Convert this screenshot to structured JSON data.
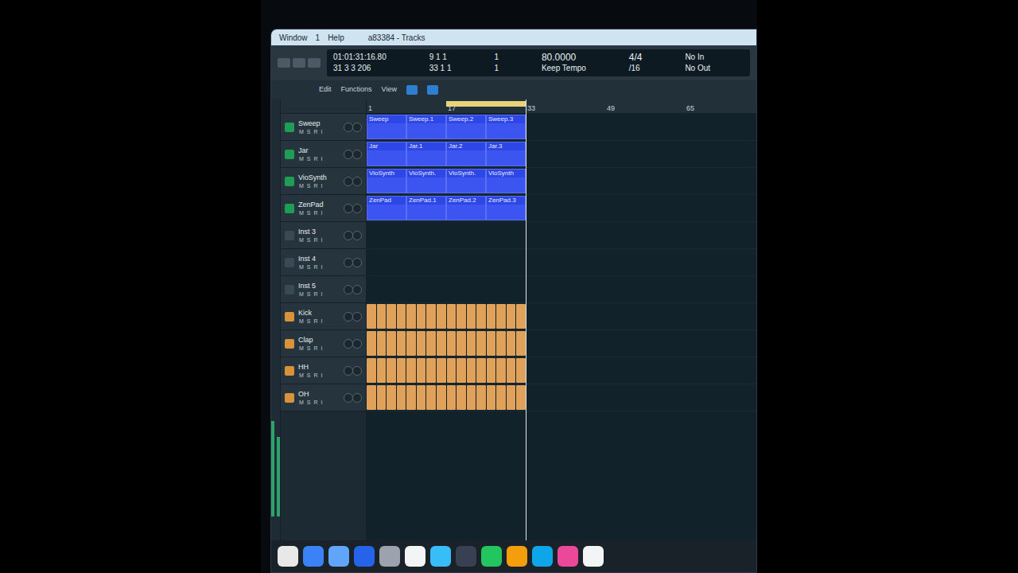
{
  "menu": {
    "items": [
      "Window",
      "1",
      "Help"
    ],
    "title": "a83384 - Tracks"
  },
  "lcd": {
    "time": "01:01:31:16.80",
    "bars": "31 3 3 206",
    "position_top": "9 1 1",
    "position_bottom": "33 1 1",
    "one_top": "1",
    "one_bottom": "1",
    "tempo": "80.0000",
    "tempo_mode": "Keep Tempo",
    "signature": "4/4",
    "division": "/16",
    "input": "No In",
    "output": "No Out"
  },
  "toolbar": [
    "Edit",
    "Functions",
    "View"
  ],
  "ruler": [
    "1",
    "17",
    "33",
    "49",
    "65"
  ],
  "tracks": [
    {
      "name": "Sweep",
      "kind": "audio",
      "active": true,
      "level": 0.55,
      "regions": [
        "Sweep",
        "Sweep.1",
        "Sweep.2",
        "Sweep.3"
      ]
    },
    {
      "name": "Jar",
      "kind": "audio",
      "active": true,
      "level": 0.6,
      "regions": [
        "Jar",
        "Jar.1",
        "Jar.2",
        "Jar.3"
      ]
    },
    {
      "name": "VioSynth",
      "kind": "audio",
      "active": true,
      "level": 0.6,
      "regions": [
        "VioSynth",
        "VioSynth.",
        "VioSynth.",
        "VioSynth"
      ]
    },
    {
      "name": "ZenPad",
      "kind": "audio",
      "active": true,
      "level": 0.65,
      "regions": [
        "ZenPad",
        "ZenPad.1",
        "ZenPad.2",
        "ZenPad.3"
      ]
    },
    {
      "name": "Inst 3",
      "kind": "inst",
      "active": false,
      "level": 0.45,
      "regions": []
    },
    {
      "name": "Inst 4",
      "kind": "inst",
      "active": false,
      "level": 0.45,
      "regions": []
    },
    {
      "name": "Inst 5",
      "kind": "inst",
      "active": false,
      "level": 0.45,
      "regions": []
    },
    {
      "name": "Kick",
      "kind": "drum",
      "active": true,
      "level": 0.7,
      "regions": []
    },
    {
      "name": "Clap",
      "kind": "drum",
      "active": true,
      "level": 0.65,
      "regions": []
    },
    {
      "name": "HH",
      "kind": "drum",
      "active": true,
      "level": 0.6,
      "regions": []
    },
    {
      "name": "OH",
      "kind": "drum",
      "active": true,
      "level": 0.6,
      "regions": []
    }
  ],
  "track_buttons": [
    "M",
    "S",
    "R",
    "I"
  ],
  "dock": [
    {
      "color": "#e8e8e8"
    },
    {
      "color": "#3b82f6"
    },
    {
      "color": "#60a5fa"
    },
    {
      "color": "#2563eb"
    },
    {
      "color": "#9ca3af"
    },
    {
      "color": "#f3f4f6"
    },
    {
      "color": "#38bdf8"
    },
    {
      "color": "#374151"
    },
    {
      "color": "#22c55e"
    },
    {
      "color": "#f59e0b"
    },
    {
      "color": "#0ea5e9"
    },
    {
      "color": "#ec4899"
    },
    {
      "color": "#f3f4f6"
    }
  ]
}
